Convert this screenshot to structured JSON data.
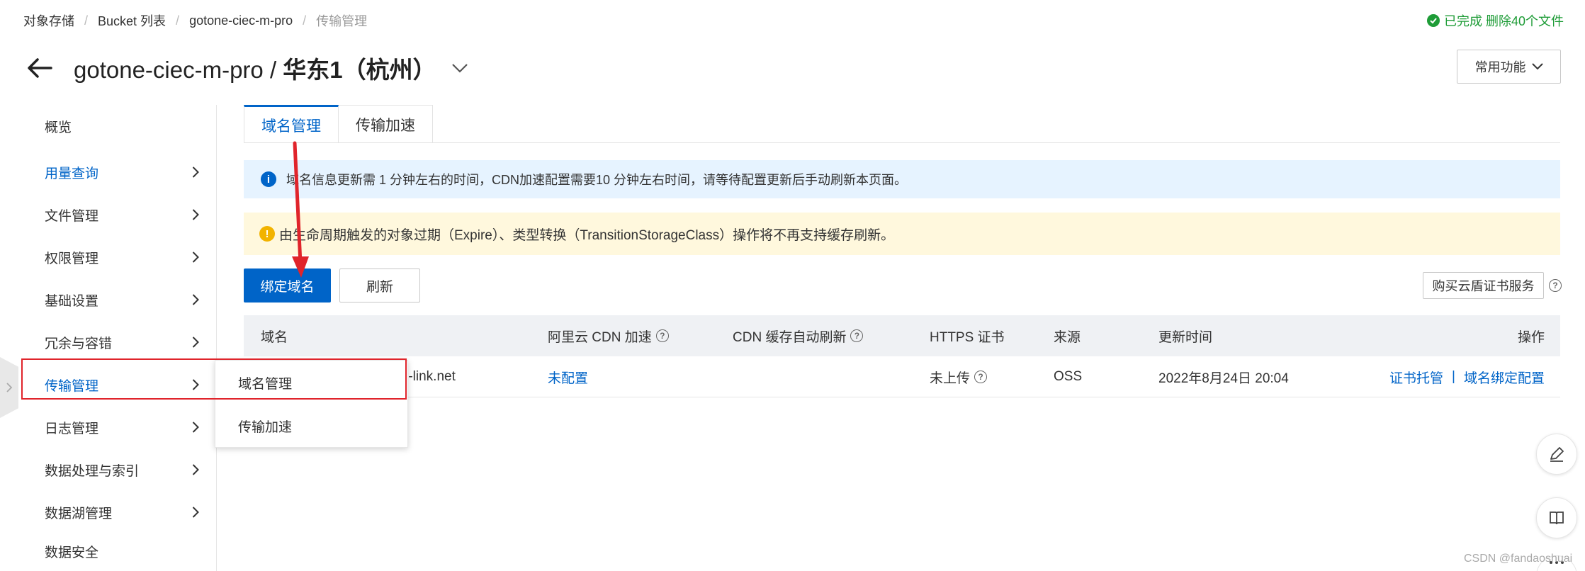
{
  "breadcrumb": {
    "items": [
      "对象存储",
      "Bucket 列表",
      "gotone-ciec-m-pro"
    ],
    "current": "传输管理"
  },
  "status": {
    "text": "已完成 删除40个文件"
  },
  "header": {
    "bucket": "gotone-ciec-m-pro / ",
    "region": "华东1（杭州）",
    "common_functions": "常用功能"
  },
  "sidebar": {
    "items": [
      {
        "label": "概览",
        "has_chevron": false
      },
      {
        "label": "用量查询",
        "has_chevron": true
      },
      {
        "label": "文件管理",
        "has_chevron": true
      },
      {
        "label": "权限管理",
        "has_chevron": true
      },
      {
        "label": "基础设置",
        "has_chevron": true
      },
      {
        "label": "冗余与容错",
        "has_chevron": true
      },
      {
        "label": "传输管理",
        "has_chevron": true
      },
      {
        "label": "日志管理",
        "has_chevron": true
      },
      {
        "label": "数据处理与索引",
        "has_chevron": true
      },
      {
        "label": "数据湖管理",
        "has_chevron": true
      },
      {
        "label": "数据安全",
        "has_chevron": false
      }
    ]
  },
  "submenu": {
    "items": [
      "域名管理",
      "传输加速"
    ]
  },
  "tabs": [
    "域名管理",
    "传输加速"
  ],
  "notices": {
    "info": "域名信息更新需 1 分钟左右的时间，CDN加速配置需要10 分钟左右时间，请等待配置更新后手动刷新本页面。",
    "warning": "由生命周期触发的对象过期（Expire）、类型转换（TransitionStorageClass）操作将不再支持缓存刷新。"
  },
  "toolbar": {
    "bind_domain": "绑定域名",
    "refresh": "刷新",
    "buy_cert": "购买云盾证书服务"
  },
  "table": {
    "headers": {
      "domain": "域名",
      "cdn": "阿里云 CDN 加速",
      "auto_refresh": "CDN 缓存自动刷新",
      "https": "HTTPS 证书",
      "source": "来源",
      "updated": "更新时间",
      "ops": "操作"
    },
    "rows": [
      {
        "domain": "r-link.net",
        "cdn": "未配置",
        "auto_refresh": "",
        "https": "未上传",
        "source": "OSS",
        "updated": "2022年8月24日 20:04",
        "op_cert": "证书托管",
        "op_sep": "|",
        "op_bind": "域名绑定配置"
      }
    ]
  },
  "watermark": "CSDN @fandaoshuai",
  "colors": {
    "accent": "#0064c8",
    "success": "#1e9c37",
    "annotation": "#e0242b",
    "info_bg": "#e6f3ff",
    "warn_bg": "#fff8dd"
  },
  "icons": [
    "check-circle-icon",
    "back-arrow-icon",
    "chevron-down-icon",
    "chevron-right-icon",
    "info-icon",
    "warning-icon",
    "help-icon",
    "edit-icon",
    "book-icon",
    "more-icon"
  ]
}
